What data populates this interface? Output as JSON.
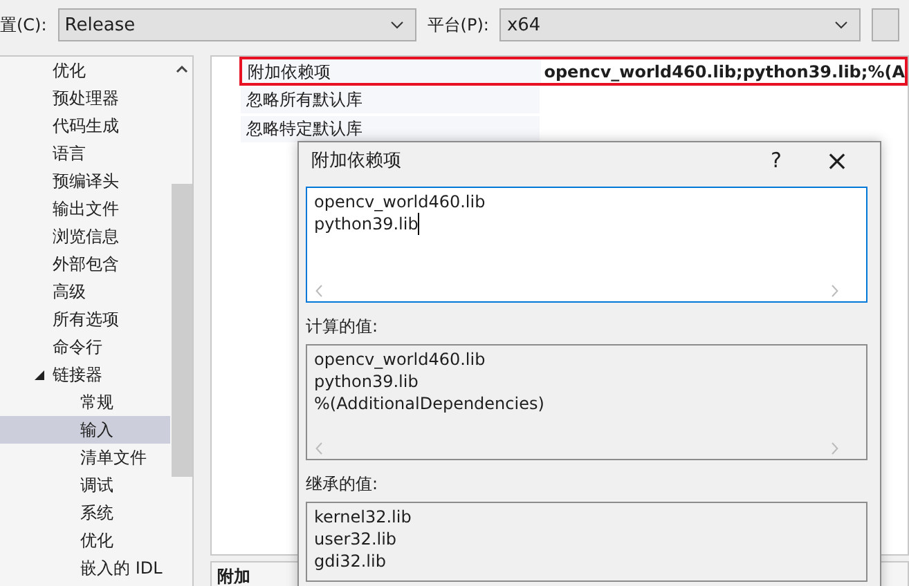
{
  "toolbar": {
    "config_label": "置(C):",
    "config_value": "Release",
    "platform_label": "平台(P):",
    "platform_value": "x64"
  },
  "tree": {
    "items": [
      {
        "label": "优化",
        "selected": false
      },
      {
        "label": "预处理器",
        "selected": false
      },
      {
        "label": "代码生成",
        "selected": false
      },
      {
        "label": "语言",
        "selected": false
      },
      {
        "label": "预编译头",
        "selected": false
      },
      {
        "label": "输出文件",
        "selected": false
      },
      {
        "label": "浏览信息",
        "selected": false
      },
      {
        "label": "外部包含",
        "selected": false
      },
      {
        "label": "高级",
        "selected": false
      },
      {
        "label": "所有选项",
        "selected": false
      },
      {
        "label": "命令行",
        "selected": false
      },
      {
        "label": "链接器",
        "selected": false,
        "expanded": true,
        "children": [
          {
            "label": "常规",
            "selected": false
          },
          {
            "label": "输入",
            "selected": true
          },
          {
            "label": "清单文件",
            "selected": false
          },
          {
            "label": "调试",
            "selected": false
          },
          {
            "label": "系统",
            "selected": false
          },
          {
            "label": "优化",
            "selected": false
          },
          {
            "label": "嵌入的 IDL",
            "selected": false
          }
        ]
      }
    ]
  },
  "properties": {
    "rows": [
      {
        "name": "附加依赖项",
        "value": "opencv_world460.lib;python39.lib;%(A",
        "highlighted": true
      },
      {
        "name": "忽略所有默认库",
        "value": "",
        "highlighted": false
      },
      {
        "name": "忽略特定默认库",
        "value": "",
        "highlighted": false
      }
    ],
    "description_title": "附加"
  },
  "dialog": {
    "title": "附加依赖项",
    "help": "?",
    "close": "×",
    "edit_lines": [
      "opencv_world460.lib",
      "python39.lib"
    ],
    "computed_label": "计算的值:",
    "computed_lines": [
      "opencv_world460.lib",
      "python39.lib",
      "%(AdditionalDependencies)"
    ],
    "inherited_label": "继承的值:",
    "inherited_lines": [
      "kernel32.lib",
      "user32.lib",
      "gdi32.lib"
    ]
  }
}
